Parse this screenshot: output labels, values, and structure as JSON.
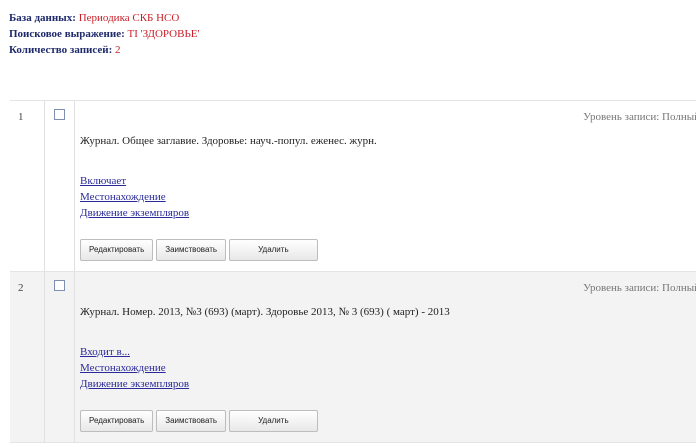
{
  "meta": {
    "database_label": "База данных:",
    "database_value": "Периодика СКБ НСО",
    "search_label": "Поисковое выражение:",
    "search_value": "TI 'ЗДОРОВЬЕ'",
    "count_label": "Количество записей:",
    "count_value": "2"
  },
  "records": [
    {
      "number": "1",
      "level": "Уровень записи: Полный",
      "description": "Журнал. Общее заглавие. Здоровье: науч.-попул. еженес. журн.",
      "links": [
        "Включает",
        "Местонахождение",
        "Движение экземпляров"
      ],
      "buttons": [
        "Редактировать",
        "Заимствовать",
        "Удалить"
      ]
    },
    {
      "number": "2",
      "level": "Уровень записи: Полный",
      "description": "Журнал. Номер. 2013, №3 (693) (март). Здоровье 2013, № 3 (693) ( март) - 2013",
      "links": [
        "Входит в...",
        "Местонахождение",
        "Движение экземпляров"
      ],
      "buttons": [
        "Редактировать",
        "Заимствовать",
        "Удалить"
      ]
    }
  ]
}
